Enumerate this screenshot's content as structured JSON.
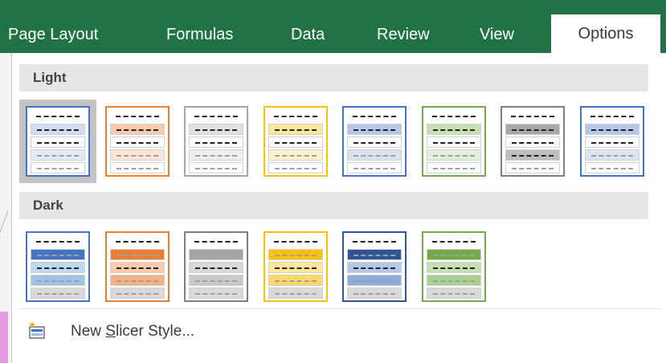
{
  "ribbon": {
    "tabs": [
      {
        "label": "Page Layout",
        "active": false
      },
      {
        "label": "Formulas",
        "active": false
      },
      {
        "label": "Data",
        "active": false
      },
      {
        "label": "Review",
        "active": false
      },
      {
        "label": "View",
        "active": false
      },
      {
        "label": "Options",
        "active": true
      }
    ],
    "color": "#217346"
  },
  "gallery": {
    "sections": [
      {
        "title": "Light",
        "styles": [
          {
            "accent": "#4472c4",
            "dash": "#222222",
            "rows": [
              "#ffffff",
              "#cfdcf3",
              "#ffffff",
              "#e3eaf7",
              "#ffffff"
            ],
            "fade": [
              false,
              false,
              false,
              true,
              true
            ],
            "selected": true
          },
          {
            "accent": "#ed7d31",
            "dash": "#222222",
            "rows": [
              "#ffffff",
              "#f8cbad",
              "#ffffff",
              "#fce4d6",
              "#ffffff"
            ],
            "fade": [
              false,
              false,
              false,
              true,
              true
            ],
            "selected": false
          },
          {
            "accent": "#a5a5a5",
            "dash": "#222222",
            "rows": [
              "#ffffff",
              "#e1e1e1",
              "#ffffff",
              "#efefef",
              "#ffffff"
            ],
            "fade": [
              false,
              false,
              false,
              true,
              true
            ],
            "selected": false
          },
          {
            "accent": "#ffc000",
            "dash": "#222222",
            "rows": [
              "#ffffff",
              "#ffe699",
              "#ffffff",
              "#fff2cc",
              "#ffffff"
            ],
            "fade": [
              false,
              false,
              false,
              true,
              true
            ],
            "selected": false
          },
          {
            "accent": "#4472c4",
            "dash": "#222222",
            "rows": [
              "#ffffff",
              "#b4c7e7",
              "#ffffff",
              "#d9e1f2",
              "#ffffff"
            ],
            "fade": [
              false,
              false,
              false,
              true,
              true
            ],
            "selected": false
          },
          {
            "accent": "#70ad47",
            "dash": "#222222",
            "rows": [
              "#ffffff",
              "#c6e0b4",
              "#ffffff",
              "#e2efda",
              "#ffffff"
            ],
            "fade": [
              false,
              false,
              false,
              true,
              true
            ],
            "selected": false
          },
          {
            "accent": "#7f7f7f",
            "dash": "#222222",
            "rows": [
              "#ffffff",
              "#a6a6a6",
              "#ffffff",
              "#bfbfbf",
              "#ffffff"
            ],
            "fade": [
              false,
              false,
              false,
              false,
              true
            ],
            "selected": false
          },
          {
            "accent": "#4472c4",
            "dash": "#222222",
            "rows": [
              "#ffffff",
              "#b4c7e7",
              "#ffffff",
              "#dbe5f1",
              "#ffffff"
            ],
            "fade": [
              false,
              false,
              false,
              true,
              true
            ],
            "selected": false
          }
        ]
      },
      {
        "title": "Dark",
        "styles": [
          {
            "accent": "#4472c4",
            "dash": "#222222",
            "rows": [
              "#ffffff",
              "#4472c4",
              "#bdd7ee",
              "#9dc3e6",
              "#d9d9d9"
            ],
            "fade": [
              false,
              true,
              false,
              true,
              true
            ],
            "selected": false
          },
          {
            "accent": "#ed7d31",
            "dash": "#222222",
            "rows": [
              "#ffffff",
              "#ed7d31",
              "#f8cbad",
              "#f4b183",
              "#d9d9d9"
            ],
            "fade": [
              false,
              true,
              false,
              true,
              true
            ],
            "selected": false
          },
          {
            "accent": "#7f7f7f",
            "dash": "#222222",
            "rows": [
              "#ffffff",
              "#a5a5a5",
              "#d9d9d9",
              "#c9c9c9",
              "#d9d9d9"
            ],
            "fade": [
              false,
              true,
              false,
              true,
              true
            ],
            "selected": false
          },
          {
            "accent": "#ffc000",
            "dash": "#222222",
            "rows": [
              "#ffffff",
              "#ffc000",
              "#ffe699",
              "#ffd966",
              "#d9d9d9"
            ],
            "fade": [
              false,
              true,
              false,
              true,
              true
            ],
            "selected": false
          },
          {
            "accent": "#2f5597",
            "dash": "#222222",
            "rows": [
              "#ffffff",
              "#2f5597",
              "#b4c7e7",
              "#8faadc",
              "#d9d9d9"
            ],
            "fade": [
              false,
              true,
              false,
              true,
              true
            ],
            "selected": false
          },
          {
            "accent": "#70ad47",
            "dash": "#222222",
            "rows": [
              "#ffffff",
              "#70ad47",
              "#c6e0b4",
              "#a9d08e",
              "#d9d9d9"
            ],
            "fade": [
              false,
              true,
              false,
              true,
              true
            ],
            "selected": false
          }
        ]
      }
    ]
  },
  "footer": {
    "label_before": "New ",
    "label_accel": "S",
    "label_after": "licer Style...",
    "icon": "new-slicer-style-icon"
  }
}
